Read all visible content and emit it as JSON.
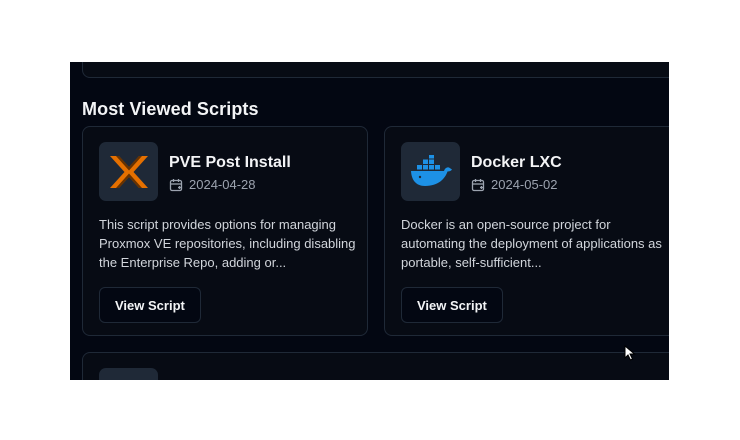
{
  "section": {
    "title": "Most Viewed Scripts"
  },
  "cards": [
    {
      "title": "PVE Post Install",
      "date": "2024-04-28",
      "description": "This script provides options for managing Proxmox VE repositories, including disabling the Enterprise Repo, adding or...",
      "button_label": "View Script",
      "icon": "proxmox-logo-icon"
    },
    {
      "title": "Docker LXC",
      "date": "2024-05-02",
      "description": "Docker is an open-source project for automating the deployment of applications as portable, self-sufficient...",
      "button_label": "View Script",
      "icon": "docker-logo-icon"
    }
  ],
  "colors": {
    "background": "#030712",
    "card": "#070b14",
    "border": "#1f2937",
    "proxmox_orange": "#e57000",
    "docker_blue": "#1d91e6"
  }
}
